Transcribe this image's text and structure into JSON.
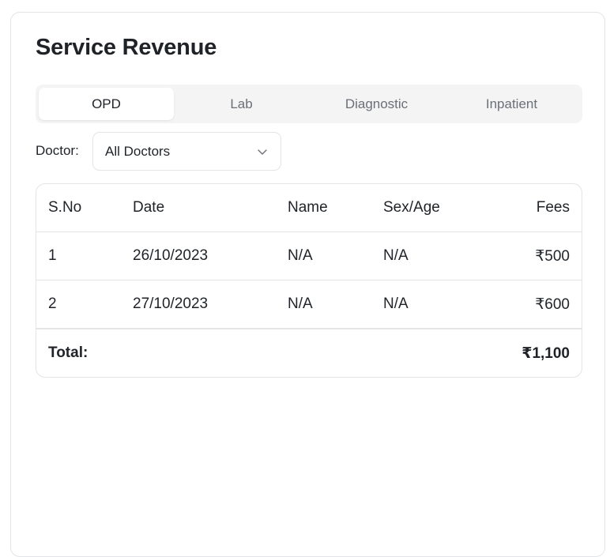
{
  "page": {
    "title": "Service Revenue"
  },
  "tabs": [
    {
      "label": "OPD",
      "active": true
    },
    {
      "label": "Lab",
      "active": false
    },
    {
      "label": "Diagnostic",
      "active": false
    },
    {
      "label": "Inpatient",
      "active": false
    }
  ],
  "filter": {
    "doctor_label": "Doctor:",
    "doctor_selected": "All Doctors"
  },
  "table": {
    "headers": {
      "sno": "S.No",
      "date": "Date",
      "name": "Name",
      "sex_age": "Sex/Age",
      "fees": "Fees"
    },
    "rows": [
      {
        "sno": "1",
        "date": "26/10/2023",
        "name": "N/A",
        "sex_age": "N/A",
        "fees": "₹500"
      },
      {
        "sno": "2",
        "date": "27/10/2023",
        "name": "N/A",
        "sex_age": "N/A",
        "fees": "₹600"
      }
    ],
    "footer": {
      "label": "Total:",
      "value": "₹1,100"
    }
  },
  "colors": {
    "border": "#e3e4e7",
    "tab_bg": "#f4f4f5",
    "text": "#1f2328",
    "muted_text": "#6b6f76"
  },
  "icons": {
    "select_chevron": "chevron-down-icon"
  }
}
